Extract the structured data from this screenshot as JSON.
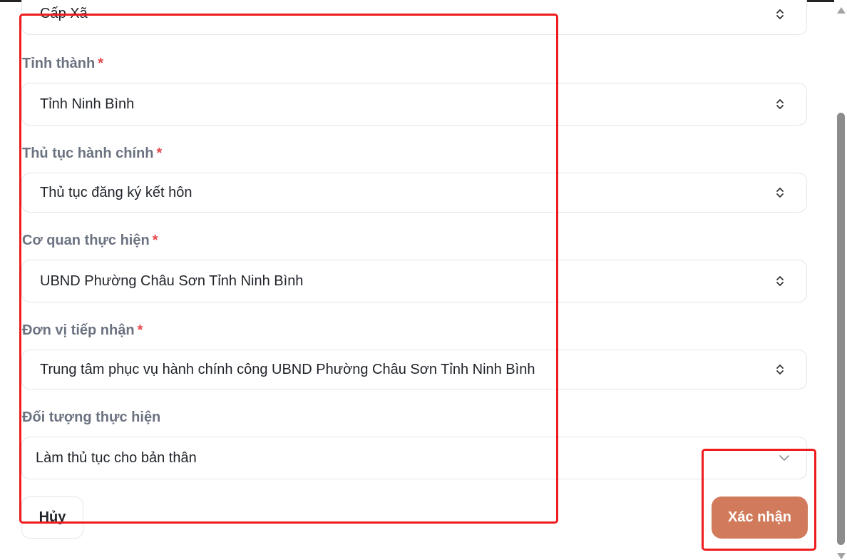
{
  "fields": [
    {
      "id": "level",
      "label": "",
      "required": false,
      "value": "Cấp Xã",
      "control": "updown"
    },
    {
      "id": "province",
      "label": "Tỉnh thành",
      "required": true,
      "value": "Tỉnh Ninh Bình",
      "control": "updown"
    },
    {
      "id": "procedure",
      "label": "Thủ tục hành chính",
      "required": true,
      "value": "Thủ tục đăng ký kết hôn",
      "control": "updown"
    },
    {
      "id": "agency",
      "label": "Cơ quan thực hiện",
      "required": true,
      "value": "UBND Phường Châu Sơn Tỉnh Ninh Bình",
      "control": "updown"
    },
    {
      "id": "receiver",
      "label": "Đơn vị tiếp nhận",
      "required": true,
      "value": "Trung tâm phục vụ hành chính công UBND Phường Châu Sơn Tỉnh Ninh Bình",
      "control": "updown"
    },
    {
      "id": "subject",
      "label": "Đối tượng thực hiện",
      "required": false,
      "value": "Làm thủ tục cho bản thân",
      "control": "down"
    }
  ],
  "required_mark": "*",
  "actions": {
    "cancel_label": "Hủy",
    "confirm_label": "Xác nhận"
  },
  "colors": {
    "confirm_bg": "#d27b5c",
    "required": "#e5484d",
    "label": "#6b7280",
    "annotation": "#ee1c1c"
  },
  "icons": {
    "updown": "chevron-up-down-icon",
    "down": "chevron-down-icon"
  }
}
